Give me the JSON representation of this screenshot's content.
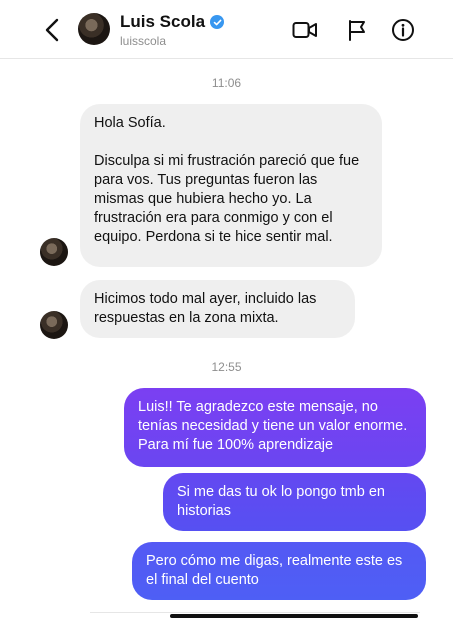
{
  "header": {
    "name": "Luis Scola",
    "handle": "luisscola",
    "verified": true
  },
  "thread": {
    "time1": "11:06",
    "time2": "12:55",
    "in_msg1": "Hola Sofía.\n\nDisculpa si mi frustración pareció que fue para vos. Tus preguntas fueron las mismas que hubiera hecho yo. La frustración era para conmigo y con el equipo. Perdona si te hice sentir mal.",
    "in_msg2": "Hicimos todo mal ayer, incluido las respuestas en la zona mixta.",
    "out_msg1": "Luis!! Te agradezco este mensaje, no tenías necesidad y tiene un valor enorme. Para mí fue 100% aprendizaje",
    "out_msg2": "Si me das tu ok lo pongo tmb en historias",
    "out_msg3": "Pero cómo me digas, realmente este es el final del cuento"
  },
  "colors": {
    "incoming_bg": "#efefef",
    "outgoing_a": "#7b3ff2",
    "outgoing_b": "#5b4ff0",
    "outgoing_c": "#4e5ff5",
    "verified": "#3897f0"
  },
  "icons": [
    "back-icon",
    "video-call-icon",
    "flag-icon",
    "info-icon",
    "verified-badge-icon"
  ]
}
